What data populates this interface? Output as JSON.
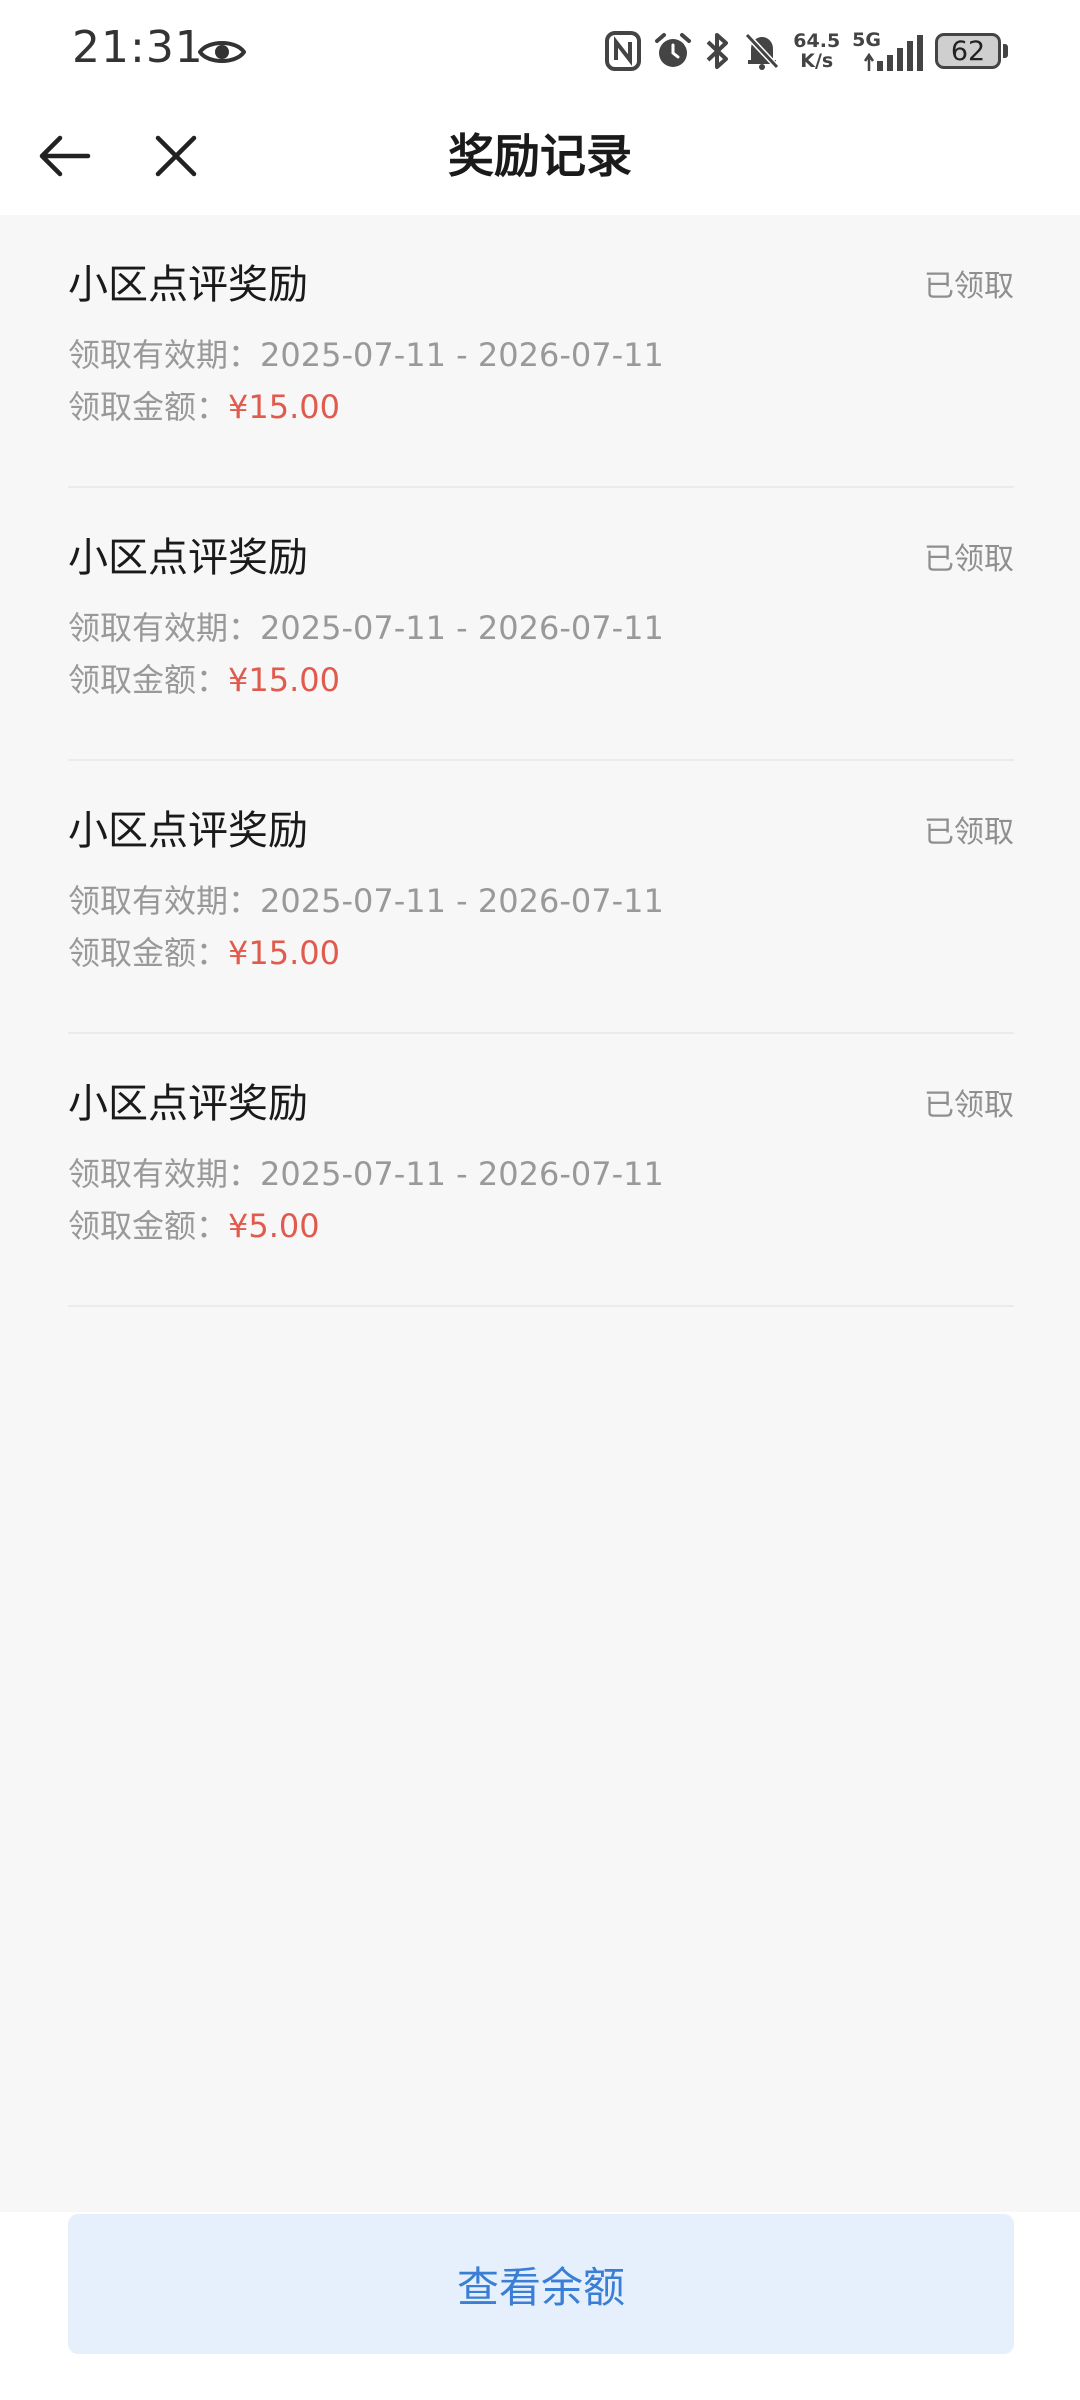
{
  "status_bar": {
    "time": "21:31",
    "net_speed_value": "64.5",
    "net_speed_unit": "K/s",
    "network_type": "5G",
    "battery_level": "62"
  },
  "header": {
    "title": "奖励记录"
  },
  "rewards": [
    {
      "title": "小区点评奖励",
      "status": "已领取",
      "period_label": "领取有效期：",
      "period": "2025-07-11 - 2026-07-11",
      "amount_label": "领取金额：",
      "amount": "¥15.00"
    },
    {
      "title": "小区点评奖励",
      "status": "已领取",
      "period_label": "领取有效期：",
      "period": "2025-07-11 - 2026-07-11",
      "amount_label": "领取金额：",
      "amount": "¥15.00"
    },
    {
      "title": "小区点评奖励",
      "status": "已领取",
      "period_label": "领取有效期：",
      "period": "2025-07-11 - 2026-07-11",
      "amount_label": "领取金额：",
      "amount": "¥15.00"
    },
    {
      "title": "小区点评奖励",
      "status": "已领取",
      "period_label": "领取有效期：",
      "period": "2025-07-11 - 2026-07-11",
      "amount_label": "领取金额：",
      "amount": "¥5.00"
    }
  ],
  "footer": {
    "balance_button_label": "查看余额"
  },
  "colors": {
    "amount": "#e05a4e",
    "button_bg": "#e6f0fc",
    "button_text": "#3a7fd5",
    "page_bg": "#f7f7f7"
  },
  "icons": {
    "back": "arrow-left-icon",
    "close": "close-icon",
    "eye": "eye-icon",
    "nfc": "nfc-icon",
    "alarm": "alarm-icon",
    "bluetooth": "bluetooth-icon",
    "mute": "bell-off-icon",
    "signal": "signal-icon",
    "battery": "battery-icon"
  }
}
